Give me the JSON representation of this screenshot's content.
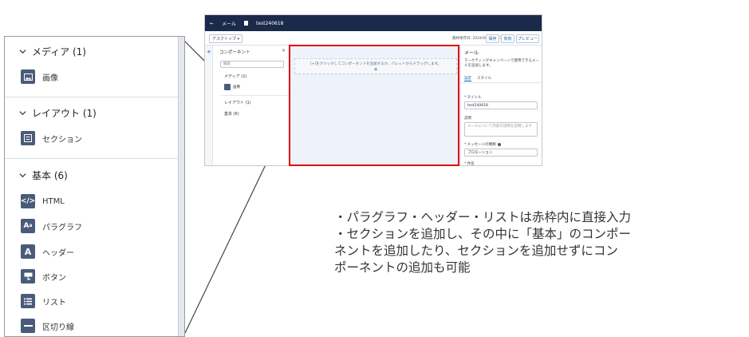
{
  "zoom_panel": {
    "sections": [
      {
        "title": "メディア (1)",
        "items": [
          {
            "label": "画像",
            "icon": "image-icon"
          }
        ]
      },
      {
        "title": "レイアウト (1)",
        "items": [
          {
            "label": "セクション",
            "icon": "section-icon"
          }
        ]
      },
      {
        "title": "基本 (6)",
        "items": [
          {
            "label": "HTML",
            "icon": "html-code-icon"
          },
          {
            "label": "パラグラフ",
            "icon": "paragraph-icon"
          },
          {
            "label": "ヘッダー",
            "icon": "header-icon"
          },
          {
            "label": "ボタン",
            "icon": "button-icon"
          },
          {
            "label": "リスト",
            "icon": "list-icon"
          },
          {
            "label": "区切り線",
            "icon": "divider-icon"
          }
        ]
      }
    ]
  },
  "app": {
    "topbar": {
      "back": "←",
      "tab_label": "メール",
      "record_name": "test240618"
    },
    "toolbar": {
      "device_select": "デスクトップ ▾",
      "status": "最終保存日: 2024/06/18 15:27",
      "save": "保存",
      "activate": "有効",
      "preview": "プレビュー"
    },
    "components_panel": {
      "title": "コンポーネント",
      "close": "×",
      "search_placeholder": "検索",
      "media": "メディア (1)",
      "image": "画像",
      "layout": "レイアウト (1)",
      "basic": "基本 (6)"
    },
    "canvas": {
      "drop_hint": "[+]をクリックしてコンポーネントを追加するか、パレットからドラッグします。",
      "plus": "+"
    },
    "properties": {
      "title": "メール",
      "description": "マーケティングキャンペーンで使用できるメールを追加します。",
      "tab_settings": "設定",
      "tab_style": "スタイル",
      "title_label": "* タイトル",
      "title_value": "test240618",
      "desc_label": "説明",
      "desc_placeholder": "メールについて内容の説明を説明します",
      "message_type_label": "* メッセージの種類",
      "message_type_value": "プロモーション",
      "name_label": "* 件名"
    }
  },
  "notes": [
    "・パラグラフ・ヘッダー・リストは赤枠内に直接入力",
    "・セクションを追加し、その中に「基本」のコンポー",
    "ネントを追加したり、セクションを追加せずにコン",
    "ポーネントの追加も可能"
  ],
  "colors": {
    "highlight": "#e00000",
    "icon_bg": "#4a5b7a",
    "topbar": "#1b2a4a",
    "accent": "#0b5cab"
  }
}
